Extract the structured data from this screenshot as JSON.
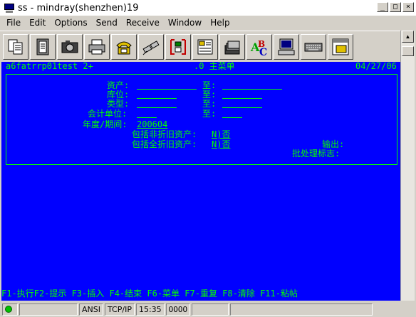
{
  "window": {
    "title": "ss - mindray(shenzhen)19",
    "minimize": "_",
    "maximize": "□",
    "close": "×"
  },
  "menu": [
    "File",
    "Edit",
    "Options",
    "Send",
    "Receive",
    "Window",
    "Help"
  ],
  "toolbar_icons": [
    "copy-icon",
    "paste-icon",
    "camera-icon",
    "print-icon",
    "phone-icon",
    "disconnect-icon",
    "transfer-icon",
    "settings-icon",
    "folders-icon",
    "spellcheck-icon",
    "computer-icon",
    "keyboard-icon",
    "screen-icon"
  ],
  "terminal": {
    "header_left": "a6fatrrp01test 2+",
    "header_center": ".0 主菜单",
    "header_date": "04/27/06",
    "labels": {
      "asset": "资产:",
      "location": "库位:",
      "type": "类型:",
      "account_unit": "会计单位:",
      "year_period": "年度/期间:",
      "include_non_dep": "包括非折旧资产:",
      "include_full_dep": "包括全折旧资产:",
      "output": "输出:",
      "batch_flag": "批处理标志:",
      "to": "至:"
    },
    "values": {
      "year_period": "200604",
      "include_non_dep": "N)否",
      "include_full_dep": "N)否"
    },
    "function_keys": "F1-执行F2-提示 F3-插入 F4-结束 F6-菜单 F7-重复 F8-清除 F11-粘帖"
  },
  "status": {
    "encoding": "ANSI",
    "protocol": "TCP/IP",
    "time": "15:35",
    "indicator": "OOOO"
  },
  "colors": {
    "terminal_bg": "#0000ff",
    "terminal_fg": "#00ff00",
    "chrome": "#d4d0c8"
  }
}
